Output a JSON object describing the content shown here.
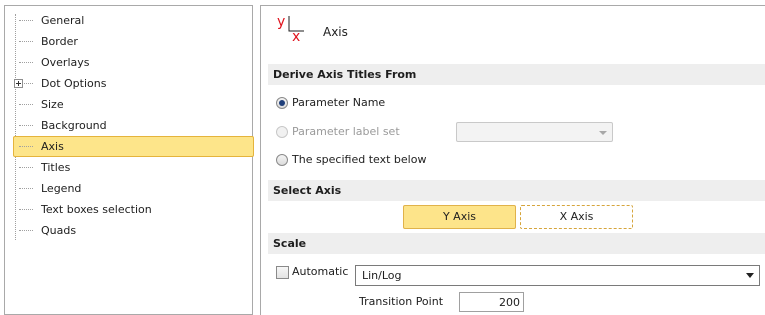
{
  "tree": {
    "items": [
      {
        "label": "General"
      },
      {
        "label": "Border"
      },
      {
        "label": "Overlays"
      },
      {
        "label": "Dot Options"
      },
      {
        "label": "Size"
      },
      {
        "label": "Background"
      },
      {
        "label": "Axis"
      },
      {
        "label": "Titles"
      },
      {
        "label": "Legend"
      },
      {
        "label": "Text boxes selection"
      },
      {
        "label": "Quads"
      }
    ],
    "selected": "Axis"
  },
  "panel": {
    "icon": "axis-yx-icon",
    "icon_y": "y",
    "icon_x": "x",
    "title": "Axis"
  },
  "derive": {
    "header": "Derive Axis Titles From",
    "option_param_name": "Parameter Name",
    "option_param_label_set": "Parameter label set",
    "option_specified_text": "The specified text below",
    "selected": "Parameter Name",
    "label_set_value": ""
  },
  "select_axis": {
    "header": "Select Axis",
    "y_axis": "Y Axis",
    "x_axis": "X Axis",
    "active": "Y Axis"
  },
  "scale": {
    "header": "Scale",
    "automatic_label": "Automatic",
    "automatic_checked": false,
    "scale_type": "Lin/Log",
    "transition_label": "Transition Point",
    "transition_value": "200"
  },
  "colors": {
    "selection": "#fde58a",
    "selection_border": "#e5b43c",
    "icon_red": "#e0141e"
  }
}
